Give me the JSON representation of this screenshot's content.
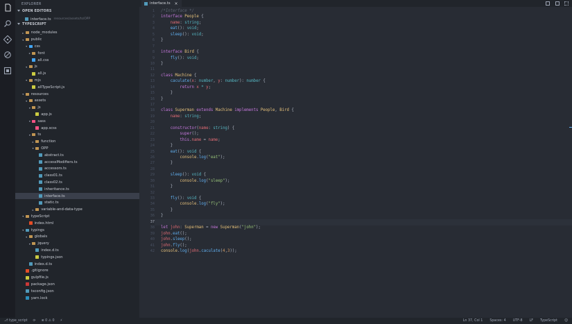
{
  "sidebar": {
    "title": "EXPLORER",
    "open_editors_title": "OPEN EDITORS",
    "open_editor": {
      "name": "interface.ts",
      "path": "resources/assets/ts/OPP"
    },
    "project_title": "TYPESCRIPT",
    "tree": [
      {
        "label": "node_modules",
        "depth": 1,
        "kind": "folder",
        "open": false
      },
      {
        "label": "public",
        "depth": 1,
        "kind": "folder",
        "open": true
      },
      {
        "label": "css",
        "depth": 2,
        "kind": "folder-css",
        "open": true
      },
      {
        "label": "font",
        "depth": 3,
        "kind": "folder",
        "open": false
      },
      {
        "label": "all.css",
        "depth": 3,
        "kind": "css"
      },
      {
        "label": "js",
        "depth": 2,
        "kind": "folder",
        "open": true
      },
      {
        "label": "all.js",
        "depth": 3,
        "kind": "js"
      },
      {
        "label": "mjs",
        "depth": 2,
        "kind": "folder",
        "open": true
      },
      {
        "label": "allTypeScript.js",
        "depth": 3,
        "kind": "js"
      },
      {
        "label": "resources",
        "depth": 1,
        "kind": "folder",
        "open": true
      },
      {
        "label": "assets",
        "depth": 2,
        "kind": "folder",
        "open": true
      },
      {
        "label": "js",
        "depth": 3,
        "kind": "folder",
        "open": true
      },
      {
        "label": "app.js",
        "depth": 4,
        "kind": "js"
      },
      {
        "label": "sass",
        "depth": 3,
        "kind": "folder-sass",
        "open": true
      },
      {
        "label": "app.scss",
        "depth": 4,
        "kind": "scss"
      },
      {
        "label": "ts",
        "depth": 3,
        "kind": "folder",
        "open": true
      },
      {
        "label": "function",
        "depth": 4,
        "kind": "folder",
        "open": false
      },
      {
        "label": "OPP",
        "depth": 4,
        "kind": "folder",
        "open": true
      },
      {
        "label": "abstract.ts",
        "depth": 5,
        "kind": "ts"
      },
      {
        "label": "accessModifiers.ts",
        "depth": 5,
        "kind": "ts"
      },
      {
        "label": "accessors.ts",
        "depth": 5,
        "kind": "ts"
      },
      {
        "label": "class01.ts",
        "depth": 5,
        "kind": "ts"
      },
      {
        "label": "class02.ts",
        "depth": 5,
        "kind": "ts"
      },
      {
        "label": "inheritance.ts",
        "depth": 5,
        "kind": "ts"
      },
      {
        "label": "interface.ts",
        "depth": 5,
        "kind": "ts",
        "selected": true
      },
      {
        "label": "static.ts",
        "depth": 5,
        "kind": "ts"
      },
      {
        "label": "variable-and-data-type",
        "depth": 4,
        "kind": "folder",
        "open": false
      },
      {
        "label": "typeScript",
        "depth": 1,
        "kind": "folder",
        "open": true
      },
      {
        "label": "index.html",
        "depth": 2,
        "kind": "html"
      },
      {
        "label": "typings",
        "depth": 1,
        "kind": "folder-typings",
        "open": true
      },
      {
        "label": "globals",
        "depth": 2,
        "kind": "folder",
        "open": true
      },
      {
        "label": "jquery",
        "depth": 3,
        "kind": "folder",
        "open": true
      },
      {
        "label": "index.d.ts",
        "depth": 4,
        "kind": "ts"
      },
      {
        "label": "typings.json",
        "depth": 4,
        "kind": "json"
      },
      {
        "label": "index.d.ts",
        "depth": 2,
        "kind": "ts"
      },
      {
        "label": ".gitignore",
        "depth": 1,
        "kind": "git"
      },
      {
        "label": "gulpfile.js",
        "depth": 1,
        "kind": "js"
      },
      {
        "label": "package.json",
        "depth": 1,
        "kind": "npm"
      },
      {
        "label": "tsconfig.json",
        "depth": 1,
        "kind": "ts"
      },
      {
        "label": "yarn.lock",
        "depth": 1,
        "kind": "yarn"
      }
    ]
  },
  "tab": {
    "label": "interface.ts",
    "close": "×"
  },
  "code_lines": [
    [
      [
        "c",
        "/*Interface */"
      ]
    ],
    [
      [
        "k",
        "interface "
      ],
      [
        "t",
        "People"
      ],
      [
        "x",
        " {"
      ]
    ],
    [
      [
        "x",
        "    "
      ],
      [
        "p",
        "name"
      ],
      [
        "x",
        ": "
      ],
      [
        "o",
        "string"
      ],
      [
        "x",
        ";"
      ]
    ],
    [
      [
        "x",
        "    "
      ],
      [
        "f",
        "eat"
      ],
      [
        "x",
        "(): "
      ],
      [
        "o",
        "void"
      ],
      [
        "x",
        ";"
      ]
    ],
    [
      [
        "x",
        "    "
      ],
      [
        "f",
        "sleep"
      ],
      [
        "x",
        "(): "
      ],
      [
        "o",
        "void"
      ],
      [
        "x",
        ";"
      ]
    ],
    [
      [
        "x",
        "}"
      ]
    ],
    [],
    [
      [
        "k",
        "interface "
      ],
      [
        "t",
        "Bird"
      ],
      [
        "x",
        " {"
      ]
    ],
    [
      [
        "x",
        "    "
      ],
      [
        "f",
        "fly"
      ],
      [
        "x",
        "(): "
      ],
      [
        "o",
        "void"
      ],
      [
        "x",
        ";"
      ]
    ],
    [
      [
        "x",
        "}"
      ]
    ],
    [],
    [
      [
        "k",
        "class "
      ],
      [
        "t",
        "Machine"
      ],
      [
        "x",
        " {"
      ]
    ],
    [
      [
        "x",
        "    "
      ],
      [
        "f",
        "caculate"
      ],
      [
        "x",
        "("
      ],
      [
        "p",
        "x"
      ],
      [
        "x",
        ": "
      ],
      [
        "o",
        "number"
      ],
      [
        "x",
        ", "
      ],
      [
        "p",
        "y"
      ],
      [
        "x",
        ": "
      ],
      [
        "o",
        "number"
      ],
      [
        "x",
        "): "
      ],
      [
        "o",
        "number"
      ],
      [
        "x",
        " {"
      ]
    ],
    [
      [
        "x",
        "        "
      ],
      [
        "k",
        "return "
      ],
      [
        "p",
        "x"
      ],
      [
        "x",
        " "
      ],
      [
        "o",
        "*"
      ],
      [
        "x",
        " "
      ],
      [
        "p",
        "y"
      ],
      [
        "x",
        ";"
      ]
    ],
    [
      [
        "x",
        "    }"
      ]
    ],
    [
      [
        "x",
        "}"
      ]
    ],
    [],
    [
      [
        "k",
        "class "
      ],
      [
        "t",
        "Superman "
      ],
      [
        "k",
        "extends "
      ],
      [
        "t",
        "Machine "
      ],
      [
        "k",
        "implements "
      ],
      [
        "t",
        "People"
      ],
      [
        "x",
        ", "
      ],
      [
        "t",
        "Bird"
      ],
      [
        "x",
        " {"
      ]
    ],
    [
      [
        "x",
        "    "
      ],
      [
        "p",
        "name"
      ],
      [
        "x",
        ": "
      ],
      [
        "o",
        "string"
      ],
      [
        "x",
        ";"
      ]
    ],
    [],
    [
      [
        "x",
        "    "
      ],
      [
        "k",
        "constructor"
      ],
      [
        "x",
        "("
      ],
      [
        "p",
        "name"
      ],
      [
        "x",
        ": "
      ],
      [
        "o",
        "string"
      ],
      [
        "x",
        ") {"
      ]
    ],
    [
      [
        "x",
        "        "
      ],
      [
        "k",
        "super"
      ],
      [
        "x",
        "();"
      ]
    ],
    [
      [
        "x",
        "        "
      ],
      [
        "k",
        "this"
      ],
      [
        "x",
        "."
      ],
      [
        "p",
        "name"
      ],
      [
        "x",
        " = "
      ],
      [
        "p",
        "name"
      ],
      [
        "x",
        ";"
      ]
    ],
    [
      [
        "x",
        "    }"
      ]
    ],
    [
      [
        "x",
        "    "
      ],
      [
        "f",
        "eat"
      ],
      [
        "x",
        "(): "
      ],
      [
        "o",
        "void"
      ],
      [
        "x",
        " {"
      ]
    ],
    [
      [
        "x",
        "        "
      ],
      [
        "t",
        "console"
      ],
      [
        "x",
        "."
      ],
      [
        "f",
        "log"
      ],
      [
        "x",
        "("
      ],
      [
        "s",
        "\"eat\""
      ],
      [
        "x",
        ");"
      ]
    ],
    [
      [
        "x",
        "    }"
      ]
    ],
    [],
    [
      [
        "x",
        "    "
      ],
      [
        "f",
        "sleep"
      ],
      [
        "x",
        "(): "
      ],
      [
        "o",
        "void"
      ],
      [
        "x",
        " {"
      ]
    ],
    [
      [
        "x",
        "        "
      ],
      [
        "t",
        "console"
      ],
      [
        "x",
        "."
      ],
      [
        "f",
        "log"
      ],
      [
        "x",
        "("
      ],
      [
        "s",
        "\"sleep\""
      ],
      [
        "x",
        ");"
      ]
    ],
    [
      [
        "x",
        "    }"
      ]
    ],
    [],
    [
      [
        "x",
        "    "
      ],
      [
        "f",
        "fly"
      ],
      [
        "x",
        "(): "
      ],
      [
        "o",
        "void"
      ],
      [
        "x",
        " {"
      ]
    ],
    [
      [
        "x",
        "        "
      ],
      [
        "t",
        "console"
      ],
      [
        "x",
        "."
      ],
      [
        "f",
        "log"
      ],
      [
        "x",
        "("
      ],
      [
        "s",
        "\"fly\""
      ],
      [
        "x",
        ");"
      ]
    ],
    [
      [
        "x",
        "    }"
      ]
    ],
    [
      [
        "x",
        "}"
      ]
    ],
    [],
    [
      [
        "k",
        "let "
      ],
      [
        "p",
        "john"
      ],
      [
        "x",
        ": "
      ],
      [
        "t",
        "Superman"
      ],
      [
        "x",
        " = "
      ],
      [
        "k",
        "new "
      ],
      [
        "t",
        "Superman"
      ],
      [
        "x",
        "("
      ],
      [
        "s",
        "\"john\""
      ],
      [
        "x",
        ");"
      ]
    ],
    [
      [
        "p",
        "john"
      ],
      [
        "x",
        "."
      ],
      [
        "f",
        "eat"
      ],
      [
        "x",
        "();"
      ]
    ],
    [
      [
        "p",
        "john"
      ],
      [
        "x",
        "."
      ],
      [
        "f",
        "sleep"
      ],
      [
        "x",
        "();"
      ]
    ],
    [
      [
        "p",
        "john"
      ],
      [
        "x",
        "."
      ],
      [
        "f",
        "fly"
      ],
      [
        "x",
        "();"
      ]
    ],
    [
      [
        "t",
        "console"
      ],
      [
        "x",
        "."
      ],
      [
        "f",
        "log"
      ],
      [
        "x",
        "("
      ],
      [
        "p",
        "john"
      ],
      [
        "x",
        "."
      ],
      [
        "f",
        "caculate"
      ],
      [
        "x",
        "("
      ],
      [
        "n",
        "4"
      ],
      [
        "x",
        ","
      ],
      [
        "n",
        "3"
      ],
      [
        "x",
        "));"
      ]
    ]
  ],
  "status": {
    "branch": "type_script",
    "errors": "0",
    "warnings": "0",
    "position": "Ln 37, Col 1",
    "spaces": "Spaces: 4",
    "encoding": "UTF-8",
    "eol": "LF",
    "language": "TypeScript"
  }
}
